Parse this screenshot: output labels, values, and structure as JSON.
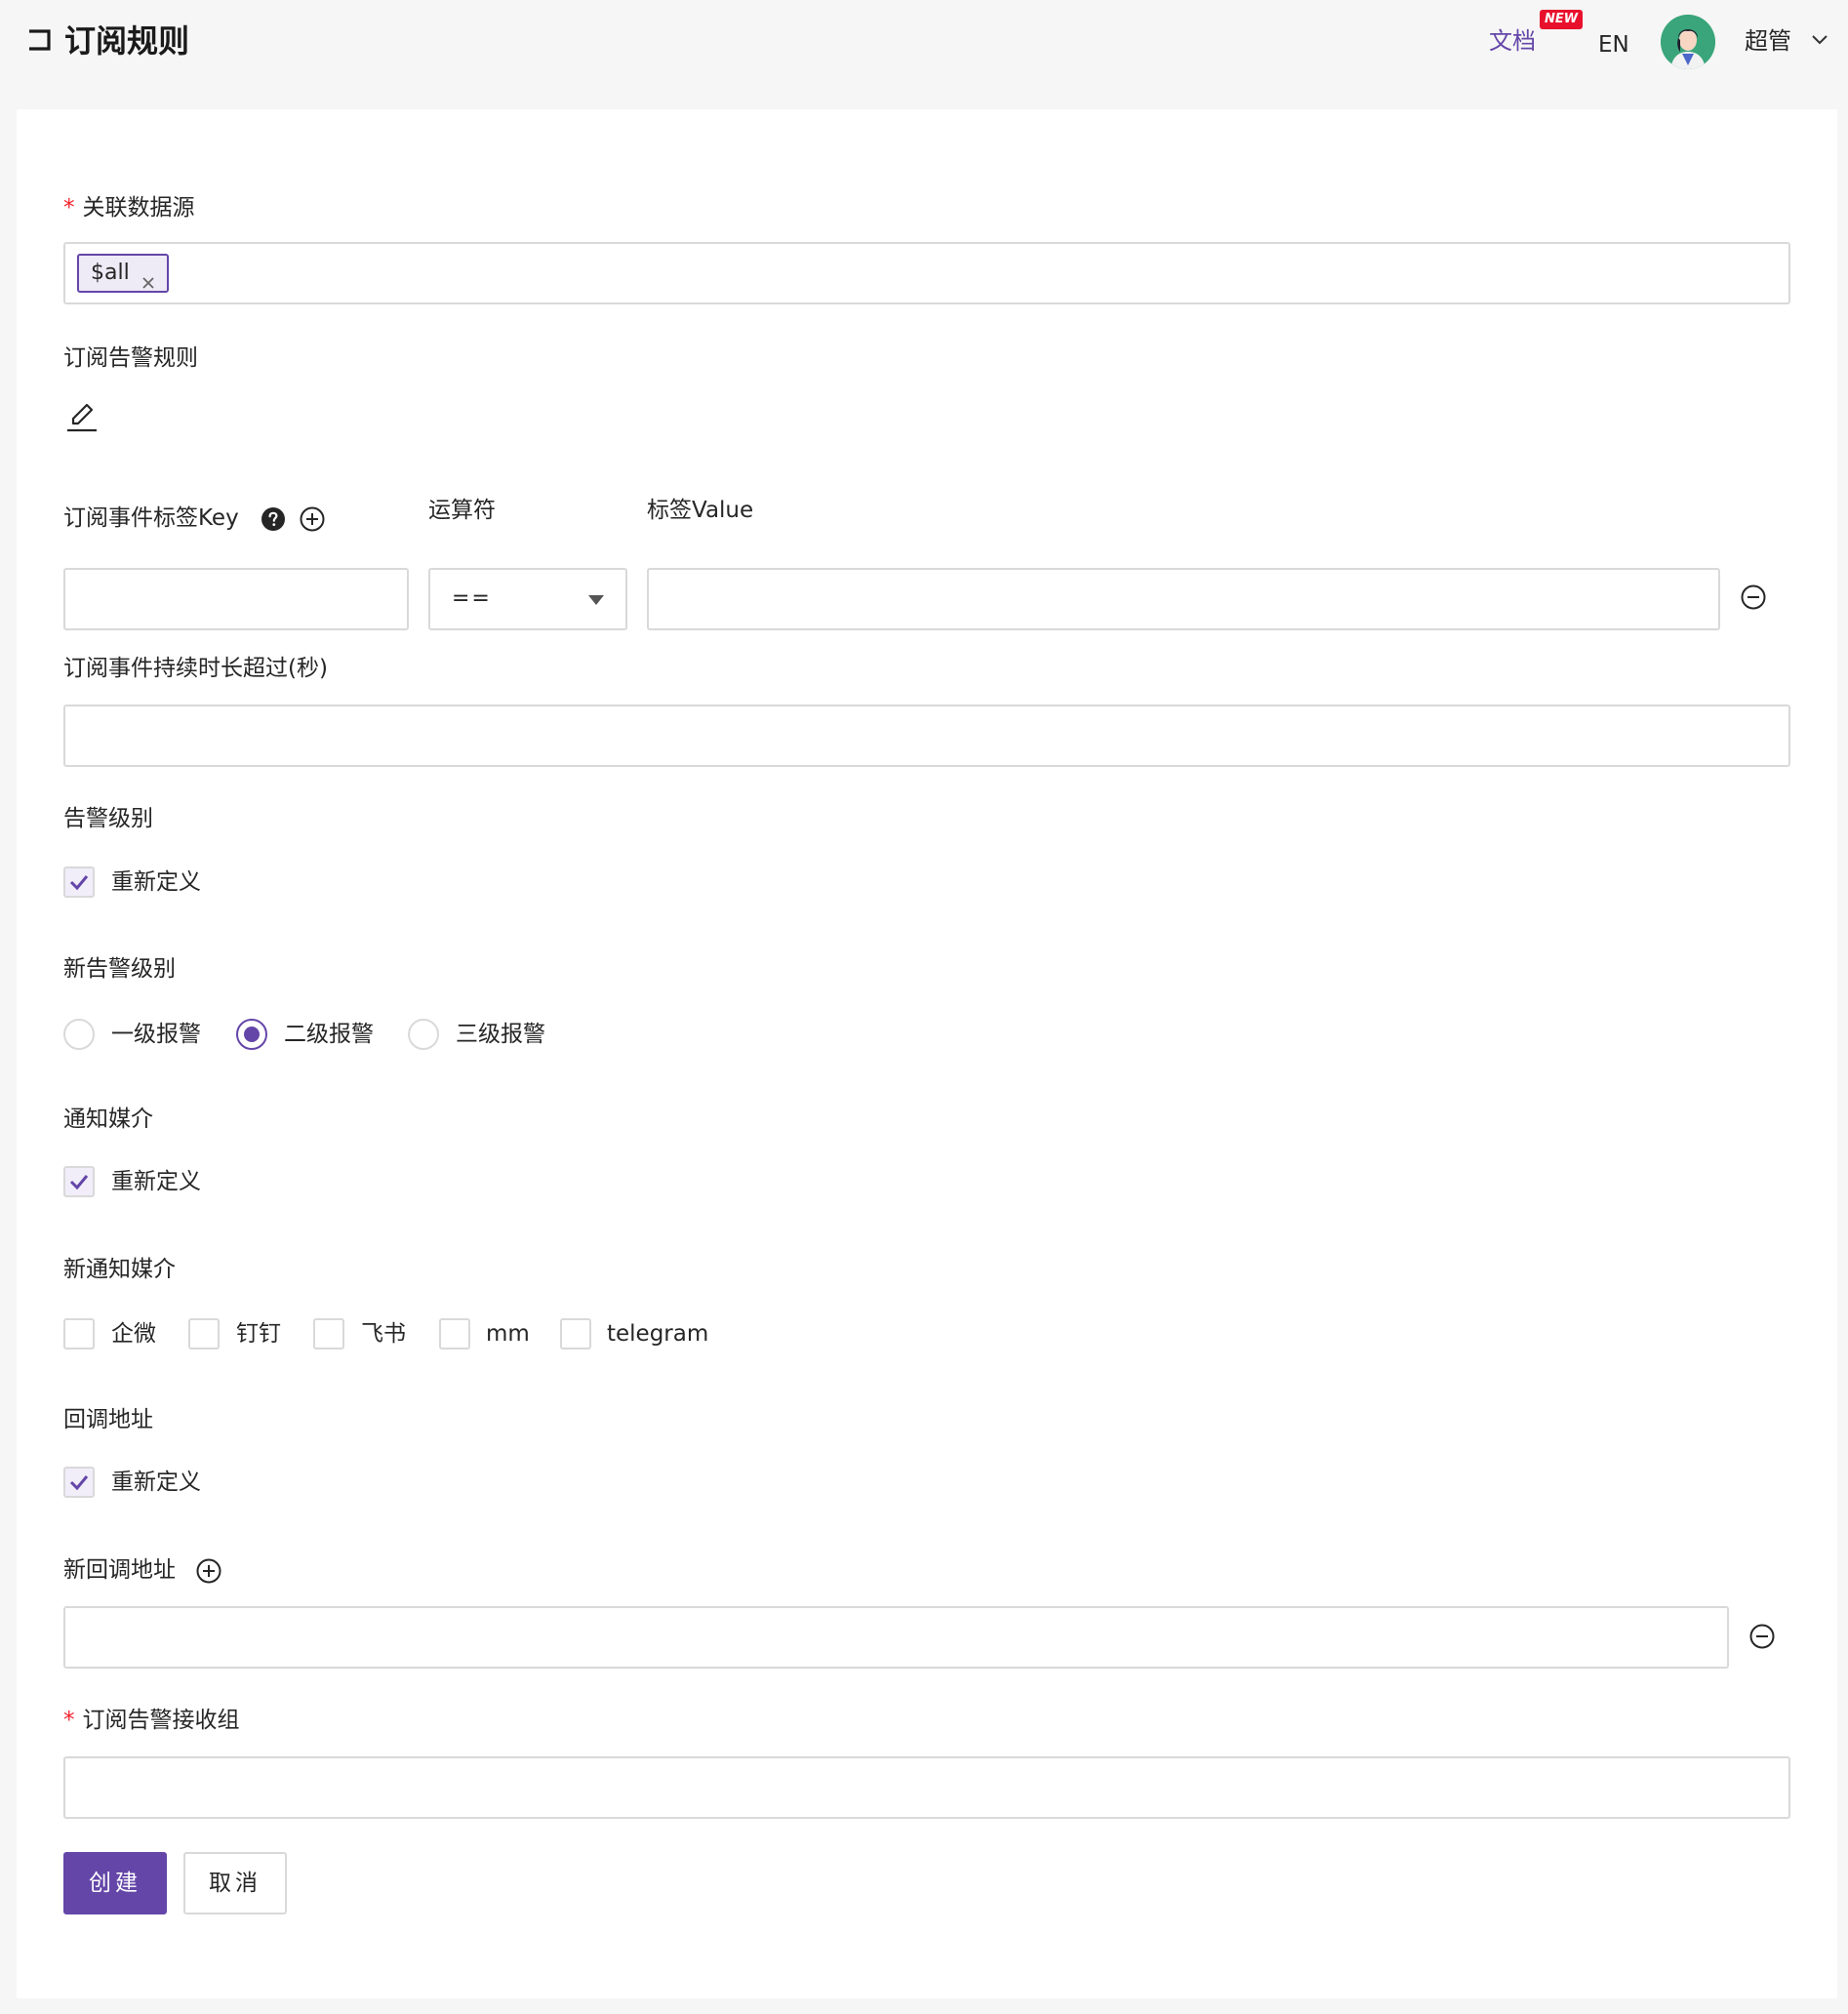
{
  "header": {
    "title": "订阅规则",
    "docs_label": "文档",
    "new_badge": "NEW",
    "lang_label": "EN",
    "username": "超管"
  },
  "colors": {
    "accent": "#6446a8",
    "required": "#f5222d",
    "badge": "#e8112d"
  },
  "form": {
    "datasource": {
      "label": "关联数据源",
      "required": true,
      "tags": [
        "$all"
      ]
    },
    "alert_rule": {
      "label": "订阅告警规则"
    },
    "tag_filter": {
      "key_label": "订阅事件标签Key",
      "operator_label": "运算符",
      "value_label": "标签Value",
      "operator_value": "==",
      "key_value": "",
      "value_value": ""
    },
    "duration": {
      "label": "订阅事件持续时长超过(秒)",
      "value": ""
    },
    "severity": {
      "label": "告警级别",
      "override_label": "重新定义",
      "override_checked": true
    },
    "new_severity": {
      "label": "新告警级别",
      "options": [
        "一级报警",
        "二级报警",
        "三级报警"
      ],
      "selected": "二级报警"
    },
    "notify_channels": {
      "label": "通知媒介",
      "override_label": "重新定义",
      "override_checked": true
    },
    "new_notify_channels": {
      "label": "新通知媒介",
      "options": [
        "企微",
        "钉钉",
        "飞书",
        "mm",
        "telegram"
      ]
    },
    "callbacks": {
      "label": "回调地址",
      "override_label": "重新定义",
      "override_checked": true
    },
    "new_callbacks": {
      "label": "新回调地址",
      "value": ""
    },
    "receiver_groups": {
      "label": "订阅告警接收组",
      "required": true,
      "value": ""
    }
  },
  "actions": {
    "create_label": "创建",
    "cancel_label": "取消"
  }
}
